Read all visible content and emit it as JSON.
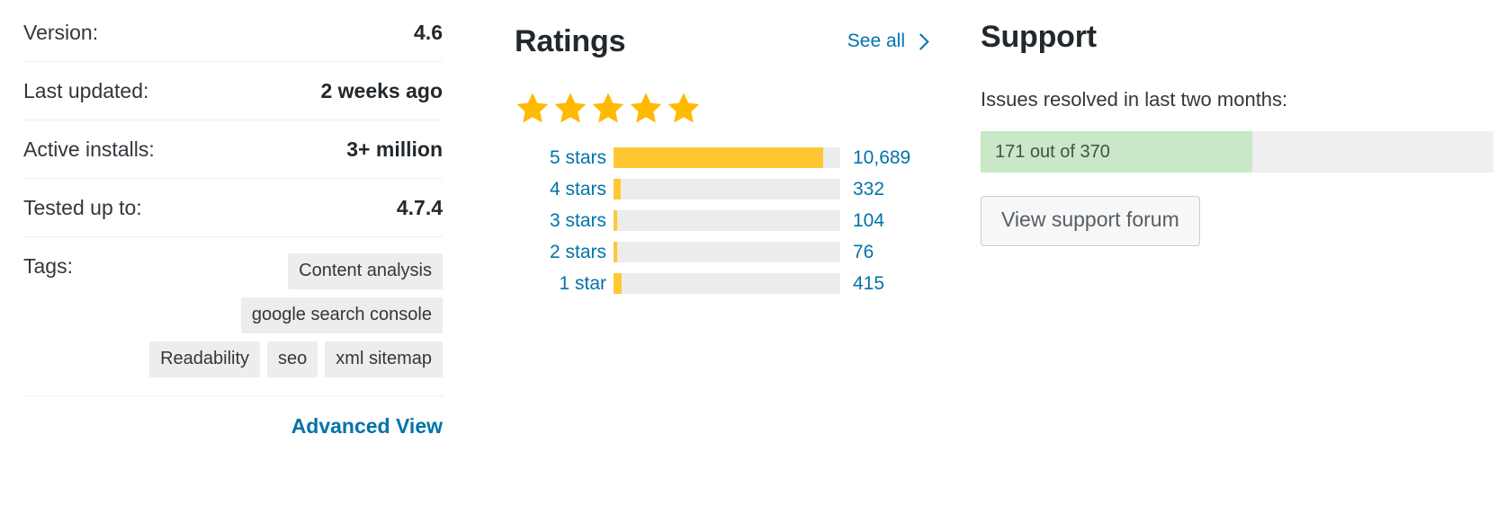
{
  "meta": {
    "rows": [
      {
        "label": "Version:",
        "value": "4.6"
      },
      {
        "label": "Last updated:",
        "value": "2 weeks ago"
      },
      {
        "label": "Active installs:",
        "value": "3+ million"
      },
      {
        "label": "Tested up to:",
        "value": "4.7.4"
      }
    ],
    "tags_label": "Tags:",
    "tags": [
      "Content analysis",
      "google search console",
      "Readability",
      "seo",
      "xml sitemap"
    ],
    "advanced_view_label": "Advanced View"
  },
  "ratings": {
    "title": "Ratings",
    "see_all_label": "See all",
    "see_all_icon": "chevron-right-icon",
    "star_icon": "star-icon",
    "stars_filled": 5,
    "stars_total": 5,
    "star_color": "#ffb900",
    "bar_fill_color": "#ffc833",
    "bar_track_color": "#ececec",
    "link_color": "#0073aa"
  },
  "support": {
    "title": "Support",
    "subtitle": "Issues resolved in last two months:",
    "meter_text": "171 out of 370",
    "meter_resolved": 171,
    "meter_total": 370,
    "meter_percent": 53,
    "meter_fill_color": "#c8e8c8",
    "meter_track_color": "#efefef",
    "forum_button_label": "View support forum"
  },
  "chart_data": {
    "type": "bar",
    "title": "Ratings",
    "orientation": "horizontal",
    "categories": [
      "5 stars",
      "4 stars",
      "3 stars",
      "2 stars",
      "1 star"
    ],
    "values": [
      10689,
      332,
      104,
      76,
      415
    ],
    "value_labels": [
      "10,689",
      "332",
      "104",
      "76",
      "415"
    ],
    "bar_percents": [
      92.5,
      3.0,
      1.2,
      1.0,
      3.7
    ],
    "xlabel": "",
    "ylabel": "",
    "grid": false,
    "legend": "none",
    "series_color": "#ffc833"
  }
}
